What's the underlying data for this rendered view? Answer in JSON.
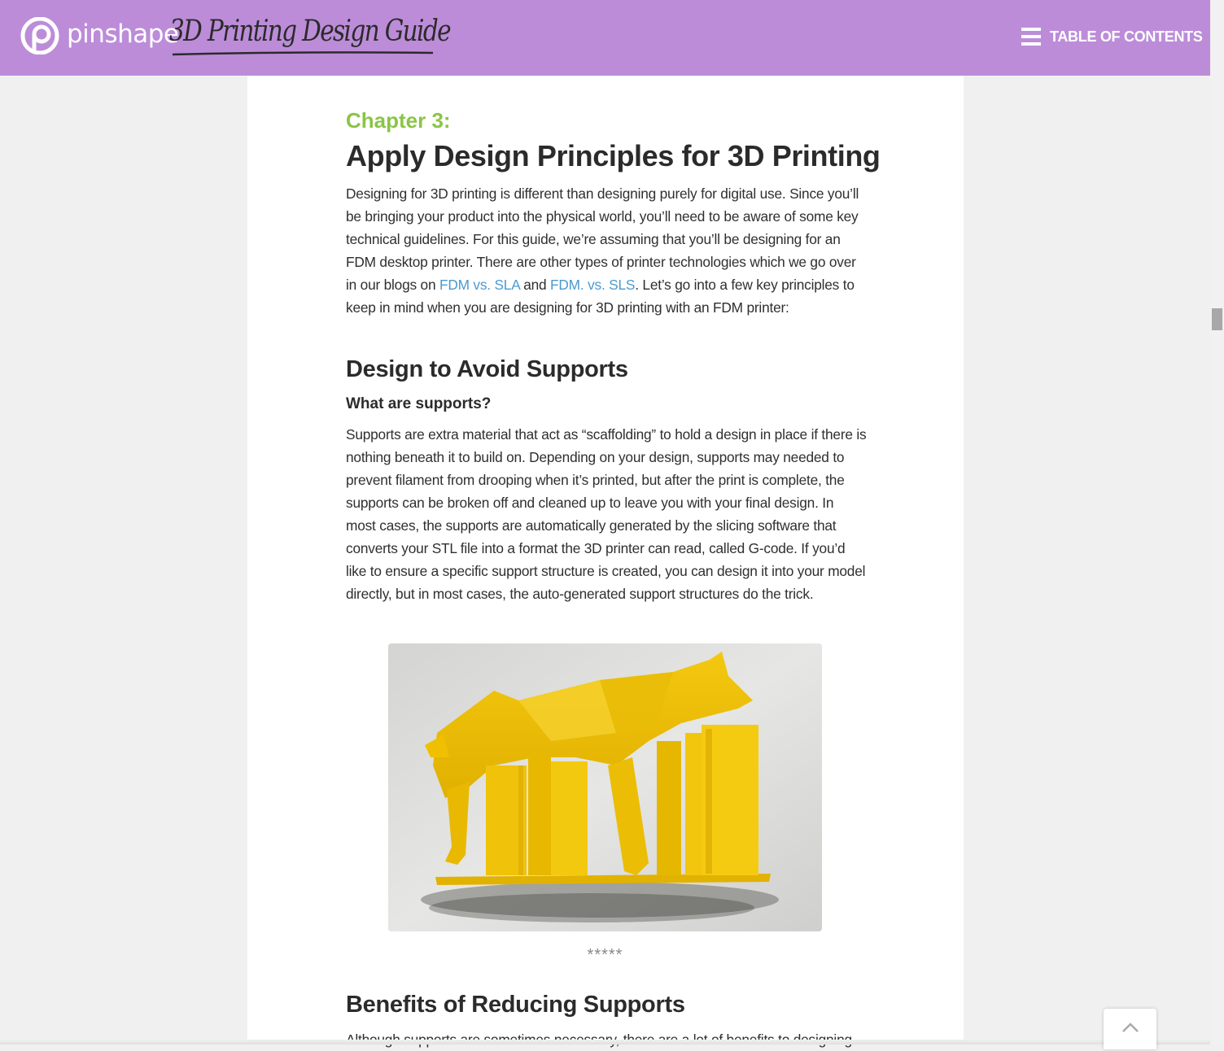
{
  "header": {
    "brand_name": "pinshape",
    "guide_title": "3D Printing Design Guide",
    "toc_label": "TABLE OF CONTENTS",
    "background_color": "#bc8cd9"
  },
  "article": {
    "chapter_label": "Chapter 3:",
    "title": "Apply Design Principles for 3D Printing",
    "intro": {
      "before_link1": "Designing for 3D printing is different than designing purely for digital use. Since you’ll be bringing your product into the physical world, you’ll need to be aware of some key technical guidelines. For this guide, we’re assuming that you’ll be designing for an FDM desktop printer. There are other types of printer technologies which we go over in our blogs on ",
      "link1": "FDM vs. SLA",
      "between": " and ",
      "link2": "FDM. vs. SLS",
      "after_link2": ". Let’s go into a few key principles to keep in mind when you are designing for 3D printing with an FDM printer:"
    },
    "section1_heading": "Design to Avoid Supports",
    "subsection_heading": "What are supports?",
    "supports_paragraph": "Supports are extra material that act as “scaffolding” to hold a design in place if there is nothing beneath it to build on. Depending on your design, supports may needed to prevent filament from drooping when it’s printed, but after the print is complete, the supports can be broken off and cleaned up to leave you with your final design. In most cases, the supports are automatically generated by the slicing software that converts your STL file into a format the 3D printer can read, called G-code. If you’d like to ensure a specific support structure is created, you can design it into your model directly, but in most cases, the auto-generated support structures do the trick.",
    "separator": "*****",
    "section2_heading": "Benefits of Reducing Supports",
    "section2_paragraph_start": "Although supports are sometimes necessary, there are a lot of benefits to designing",
    "accent_color": "#8ac547",
    "link_color": "#4a9ad1"
  },
  "icons": {
    "logo": "pinshape-logo-icon",
    "menu": "hamburger-menu-icon",
    "back_to_top": "chevron-up-icon"
  }
}
